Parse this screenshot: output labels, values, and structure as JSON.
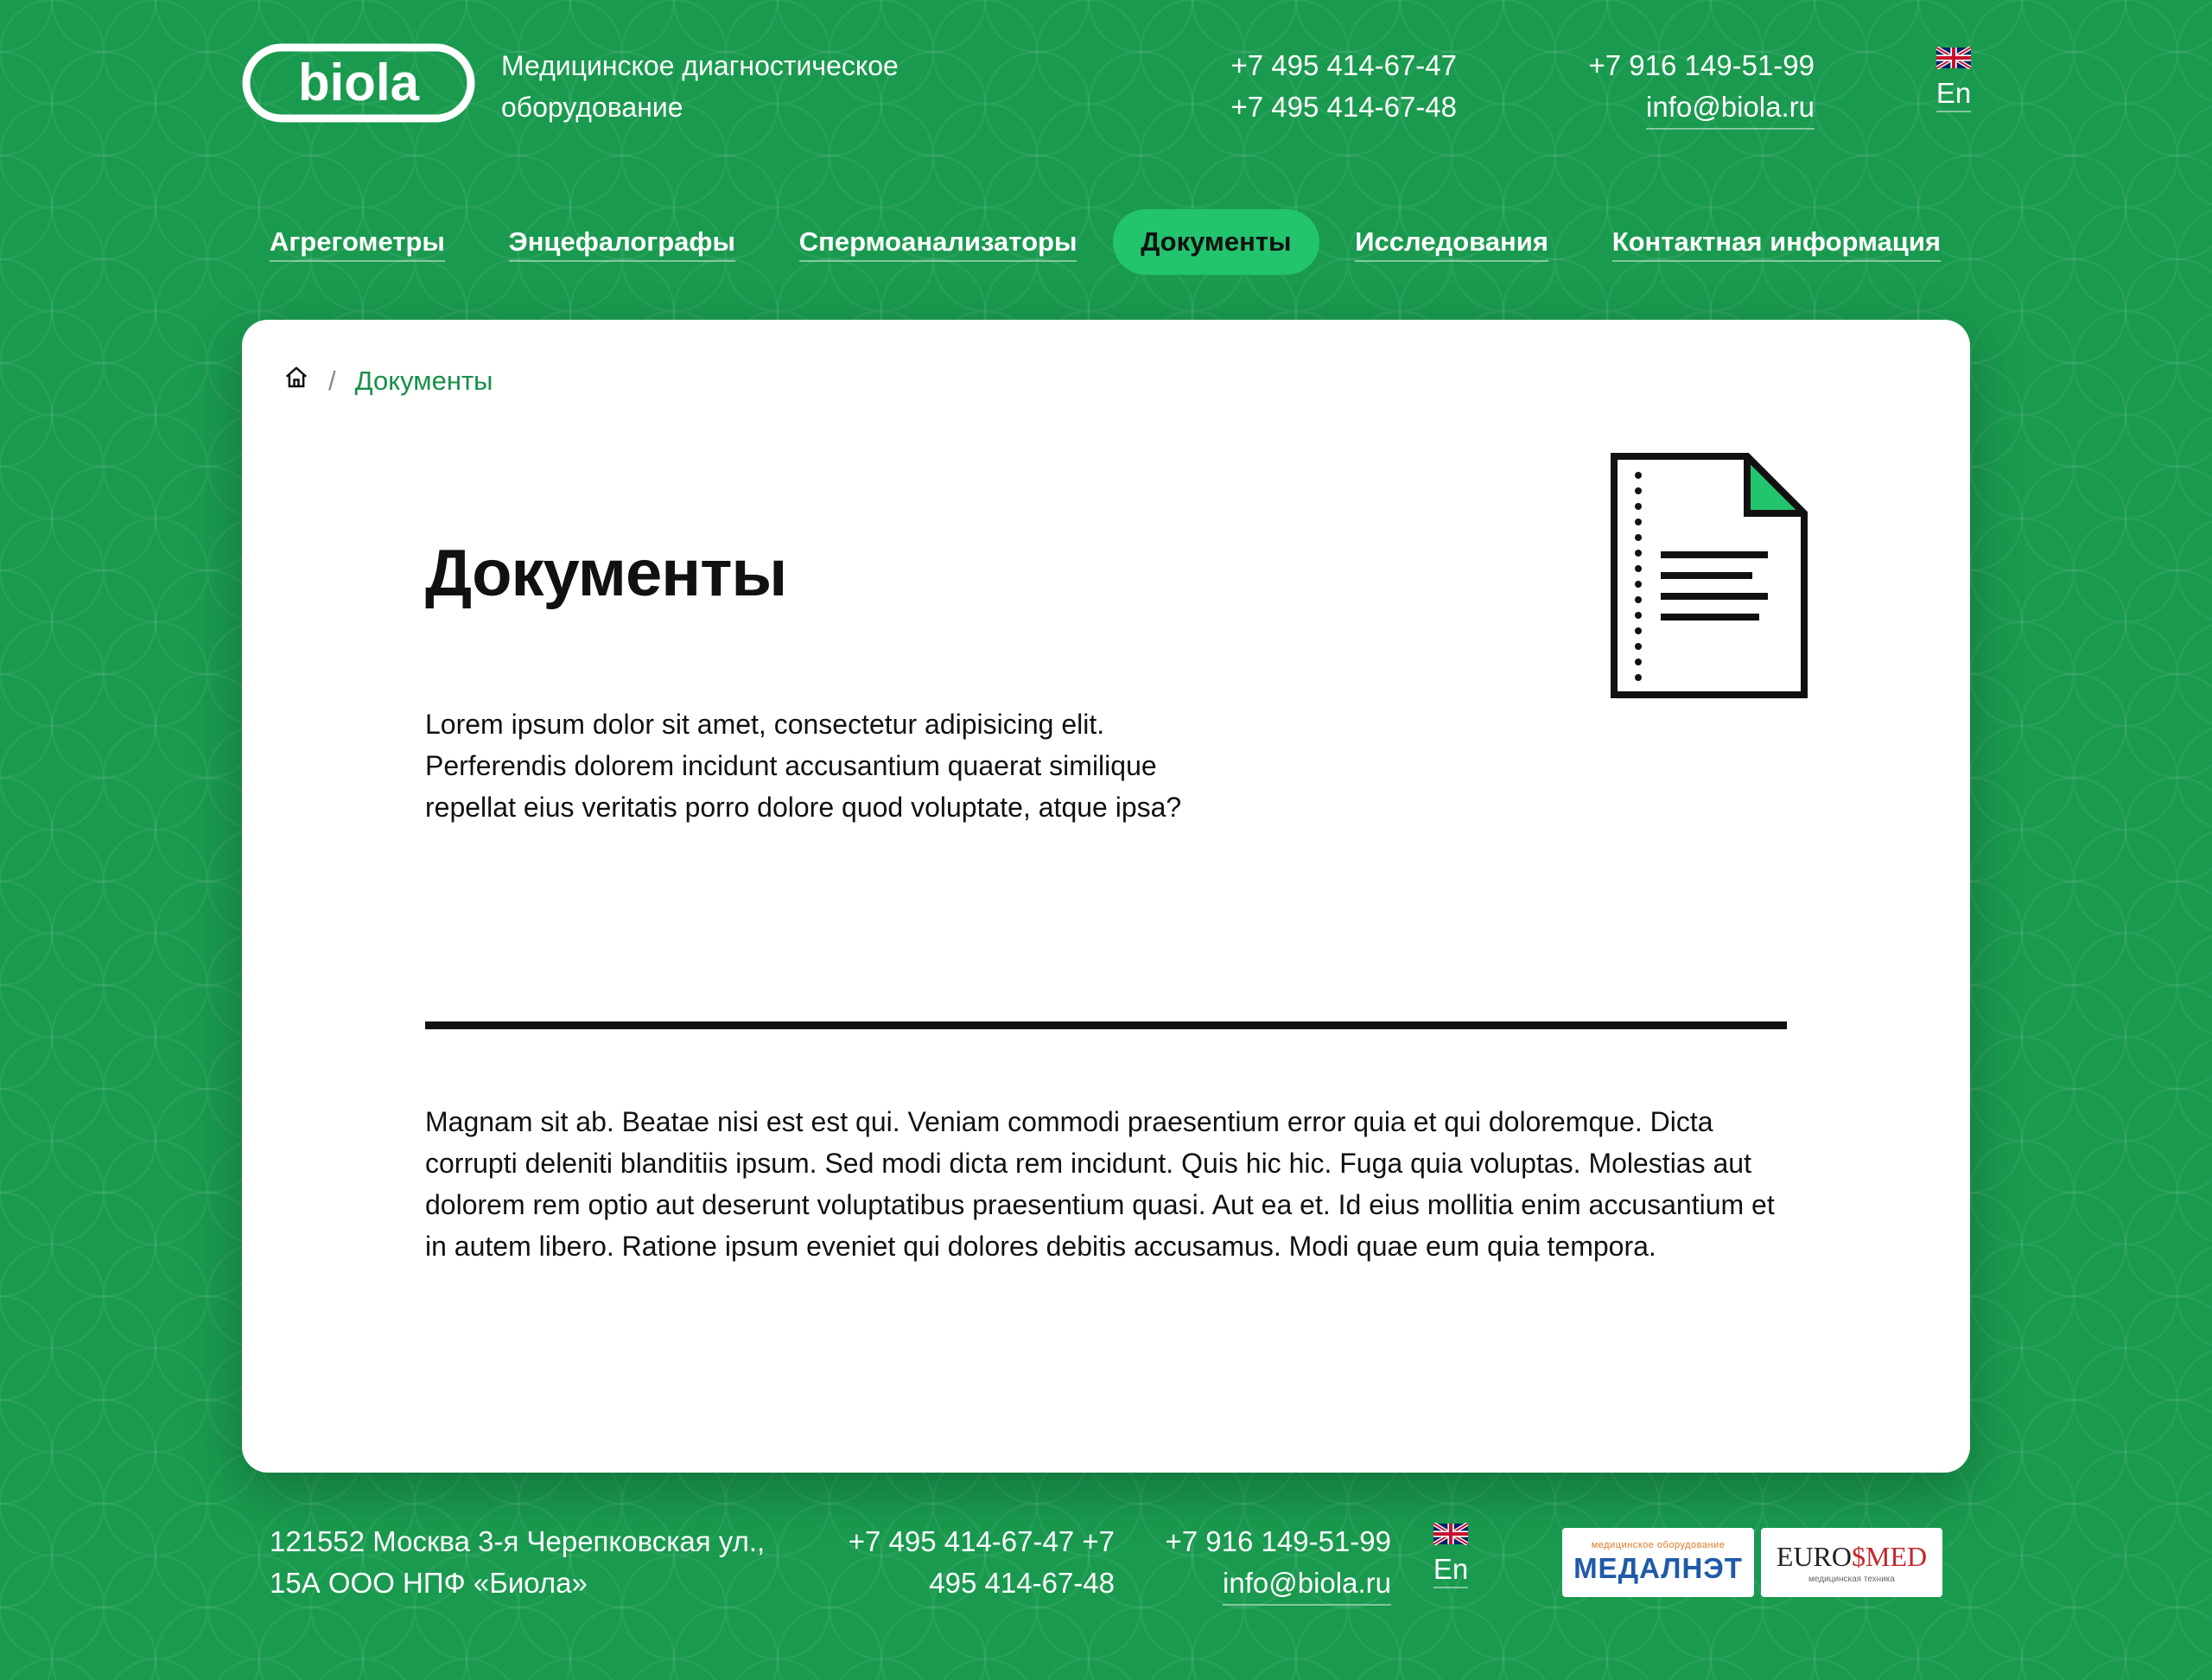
{
  "header": {
    "logo_text": "biola",
    "tagline_line1": "Медицинское диагностическое",
    "tagline_line2": "оборудование",
    "phone1": "+7 495 414-67-47",
    "phone2": "+7 495 414-67-48",
    "phone3": "+7 916 149-51-99",
    "email": "info@biola.ru",
    "lang_label": "En",
    "lang_flag_icon": "uk-flag-icon"
  },
  "nav": {
    "items": [
      {
        "label": "Агрегометры"
      },
      {
        "label": "Энцефалографы"
      },
      {
        "label": "Спермоанализаторы"
      },
      {
        "label": "Документы",
        "active": true
      },
      {
        "label": "Исследования"
      },
      {
        "label": "Контактная информация"
      }
    ]
  },
  "breadcrumb": {
    "home_icon": "home-icon",
    "separator": "/",
    "current": "Документы"
  },
  "page": {
    "title": "Документы",
    "intro": "Lorem ipsum dolor sit amet, consectetur adipisicing elit. Perferendis dolorem incidunt accusantium quaerat similique repellat eius veritatis porro dolore quod voluptate, atque ipsa?",
    "body": "Magnam sit ab. Beatae nisi est est qui. Veniam commodi praesentium error quia et qui doloremque. Dicta corrupti deleniti blanditiis ipsum. Sed modi dicta rem incidunt. Quis hic hic. Fuga quia voluptas. Molestias aut dolorem rem optio aut deserunt voluptatibus praesentium quasi. Aut ea et. Id eius mollitia enim accusantium et in autem libero. Ratione ipsum eveniet qui dolores debitis accusamus. Modi quae eum quia tempora.",
    "illustration_icon": "document-icon"
  },
  "footer": {
    "address_line1": "121552 Москва 3-я Черепковская ул.,",
    "address_line2": "15А ООО НПФ «Биола»",
    "phone1": "+7 495 414-67-47",
    "phone2": "+7 495 414-67-48",
    "phone3": "+7 916 149-51-99",
    "email": "info@biola.ru",
    "lang_label": "En",
    "partners": [
      {
        "name": "МЕДАЛНЭТ",
        "caption": "медицинское оборудование"
      },
      {
        "name_part1": "EURO",
        "name_symbol": "$",
        "name_part2": "MED",
        "caption": "медицинская техника"
      }
    ]
  },
  "colors": {
    "background_green": "#1a9a4f",
    "active_nav": "#22c46d",
    "breadcrumb_green": "#16904a",
    "doc_corner": "#22c46d"
  }
}
